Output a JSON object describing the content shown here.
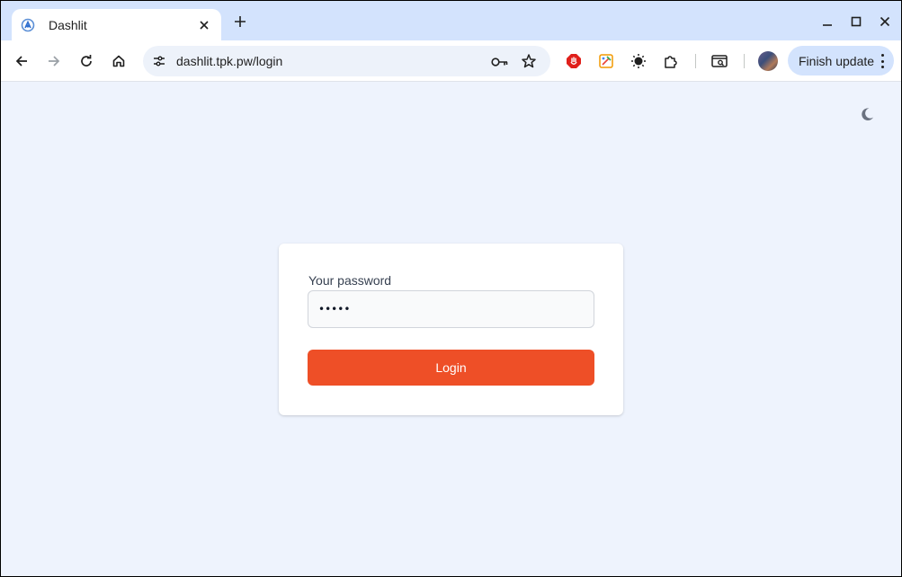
{
  "browser": {
    "tab": {
      "title": "Dashlit",
      "favicon": "dashlit-logo-icon"
    },
    "address_bar": {
      "url": "dashlit.tpk.pw/login"
    },
    "finish_update_label": "Finish update",
    "colors": {
      "tabstrip": "#d3e3fd",
      "omnibox": "#edf2fa",
      "accent_button": "#d3e3fd"
    }
  },
  "page": {
    "theme_toggle_icon": "moon-icon",
    "form": {
      "password_label": "Your password",
      "password_value": "•••••",
      "login_label": "Login"
    },
    "colors": {
      "background": "#eef3fd",
      "login_button": "#ee4f27"
    }
  }
}
